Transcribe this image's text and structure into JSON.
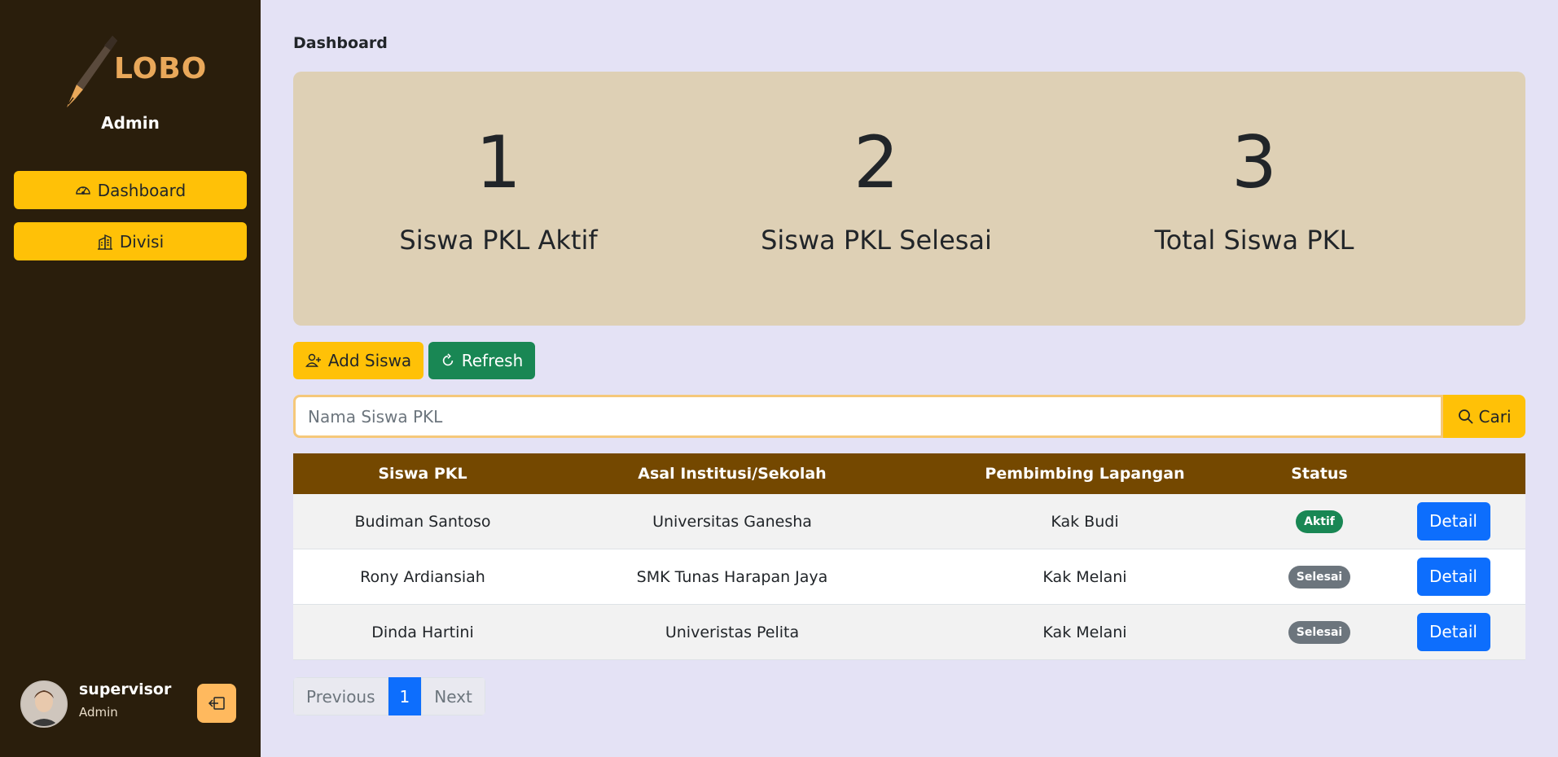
{
  "sidebar": {
    "logo_text": "LOBO",
    "role": "Admin",
    "nav": [
      {
        "label": "Dashboard",
        "icon": "speedometer-icon"
      },
      {
        "label": "Divisi",
        "icon": "buildings-icon"
      }
    ],
    "user": {
      "name": "supervisor",
      "role": "Admin"
    }
  },
  "main": {
    "title": "Dashboard",
    "stats": [
      {
        "value": "1",
        "label": "Siswa PKL Aktif"
      },
      {
        "value": "2",
        "label": "Siswa PKL Selesai"
      },
      {
        "value": "3",
        "label": "Total Siswa PKL"
      }
    ],
    "buttons": {
      "add": "Add Siswa",
      "refresh": "Refresh"
    },
    "search": {
      "placeholder": "Nama Siswa PKL",
      "button": "Cari"
    },
    "table": {
      "headers": [
        "Siswa PKL",
        "Asal Institusi/Sekolah",
        "Pembimbing Lapangan",
        "Status",
        ""
      ],
      "rows": [
        {
          "name": "Budiman Santoso",
          "school": "Universitas Ganesha",
          "mentor": "Kak Budi",
          "status": "Aktif",
          "action": "Detail"
        },
        {
          "name": "Rony Ardiansiah",
          "school": "SMK Tunas Harapan Jaya",
          "mentor": "Kak Melani",
          "status": "Selesai",
          "action": "Detail"
        },
        {
          "name": "Dinda Hartini",
          "school": "Univeristas Pelita",
          "mentor": "Kak Melani",
          "status": "Selesai",
          "action": "Detail"
        }
      ]
    },
    "pagination": {
      "previous": "Previous",
      "current": "1",
      "next": "Next"
    }
  },
  "colors": {
    "sidebar_bg": "#2a1e0c",
    "accent": "#ffc107",
    "table_header": "#744800",
    "success": "#198754",
    "primary": "#0d6efd",
    "stats_bg": "#ded0b5",
    "page_bg": "#e4e2f5"
  }
}
